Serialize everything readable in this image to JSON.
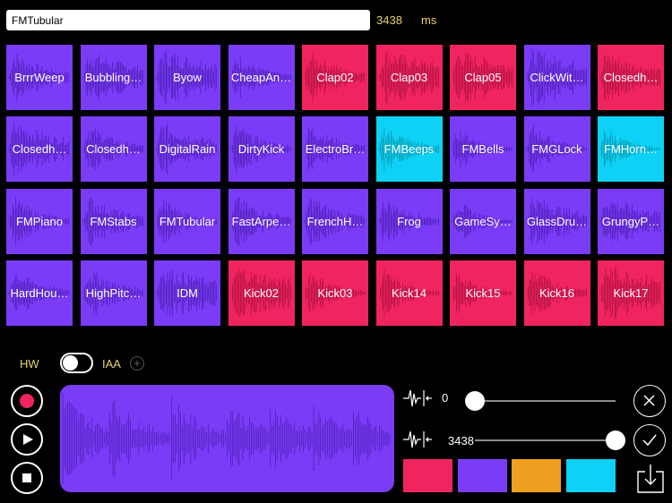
{
  "header": {
    "name_value": "FMTubular",
    "duration_value": "3438",
    "duration_unit": "ms"
  },
  "colors": {
    "purple": "#7a3cf7",
    "pink": "#f0245f",
    "cyan": "#0ed2f5",
    "orange": "#f0a020"
  },
  "pads": [
    {
      "label": "BrrrWeep",
      "color": "purple"
    },
    {
      "label": "Bubbling…",
      "color": "purple"
    },
    {
      "label": "Byow",
      "color": "purple"
    },
    {
      "label": "CheapAn…",
      "color": "purple"
    },
    {
      "label": "Clap02",
      "color": "pink"
    },
    {
      "label": "Clap03",
      "color": "pink"
    },
    {
      "label": "Clap05",
      "color": "pink"
    },
    {
      "label": "ClickWit…",
      "color": "purple"
    },
    {
      "label": "Closedh…",
      "color": "pink"
    },
    {
      "label": "Closedh…",
      "color": "purple"
    },
    {
      "label": "Closedh…",
      "color": "purple"
    },
    {
      "label": "DigitalRain",
      "color": "purple"
    },
    {
      "label": "DirtyKick",
      "color": "purple"
    },
    {
      "label": "ElectroBr…",
      "color": "purple"
    },
    {
      "label": "FMBeeps",
      "color": "cyan"
    },
    {
      "label": "FMBells",
      "color": "purple"
    },
    {
      "label": "FMGLock",
      "color": "purple"
    },
    {
      "label": "FMHorn…",
      "color": "cyan"
    },
    {
      "label": "FMPiano",
      "color": "purple"
    },
    {
      "label": "FMStabs",
      "color": "purple"
    },
    {
      "label": "FMTubular",
      "color": "purple"
    },
    {
      "label": "FastArpe…",
      "color": "purple"
    },
    {
      "label": "FrenchH…",
      "color": "purple"
    },
    {
      "label": "Frog",
      "color": "purple"
    },
    {
      "label": "GameSy…",
      "color": "purple"
    },
    {
      "label": "GlassDru…",
      "color": "purple"
    },
    {
      "label": "GrungyP…",
      "color": "purple"
    },
    {
      "label": "HardHou…",
      "color": "purple"
    },
    {
      "label": "HighPitc…",
      "color": "purple"
    },
    {
      "label": "IDM",
      "color": "purple"
    },
    {
      "label": "Kick02",
      "color": "pink"
    },
    {
      "label": "Kick03",
      "color": "pink"
    },
    {
      "label": "Kick14",
      "color": "pink"
    },
    {
      "label": "Kick15",
      "color": "pink"
    },
    {
      "label": "Kick16",
      "color": "pink"
    },
    {
      "label": "Kick17",
      "color": "pink"
    }
  ],
  "controls": {
    "hw_label": "HW",
    "iaa_label": "IAA",
    "iaa_toggle_on": false
  },
  "sliders": {
    "start_value": "0",
    "start_fraction": 0,
    "end_value": "3438",
    "end_fraction": 1
  },
  "swatches": [
    "pink",
    "purple",
    "orange",
    "cyan"
  ]
}
